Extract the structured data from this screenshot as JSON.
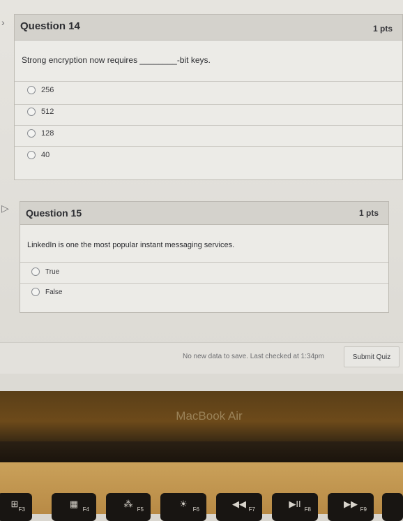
{
  "questions": [
    {
      "title": "Question 14",
      "points": "1 pts",
      "text": "Strong encryption now requires ________-bit keys.",
      "answers": [
        "256",
        "512",
        "128",
        "40"
      ]
    },
    {
      "title": "Question 15",
      "points": "1 pts",
      "text": "LinkedIn is one the most popular instant messaging services.",
      "answers": [
        "True",
        "False"
      ]
    }
  ],
  "footer": {
    "status": "No new data to save. Last checked at 1:34pm",
    "submit_label": "Submit Quiz"
  },
  "laptop": {
    "brand": "MacBook Air",
    "keys": [
      {
        "glyph": "⊞",
        "fn": "F3"
      },
      {
        "glyph": "▦",
        "fn": "F4"
      },
      {
        "glyph": "⁂",
        "fn": "F5"
      },
      {
        "glyph": "☀",
        "fn": "F6"
      },
      {
        "glyph": "◀◀",
        "fn": "F7"
      },
      {
        "glyph": "▶II",
        "fn": "F8"
      },
      {
        "glyph": "▶▶",
        "fn": "F9"
      }
    ]
  }
}
